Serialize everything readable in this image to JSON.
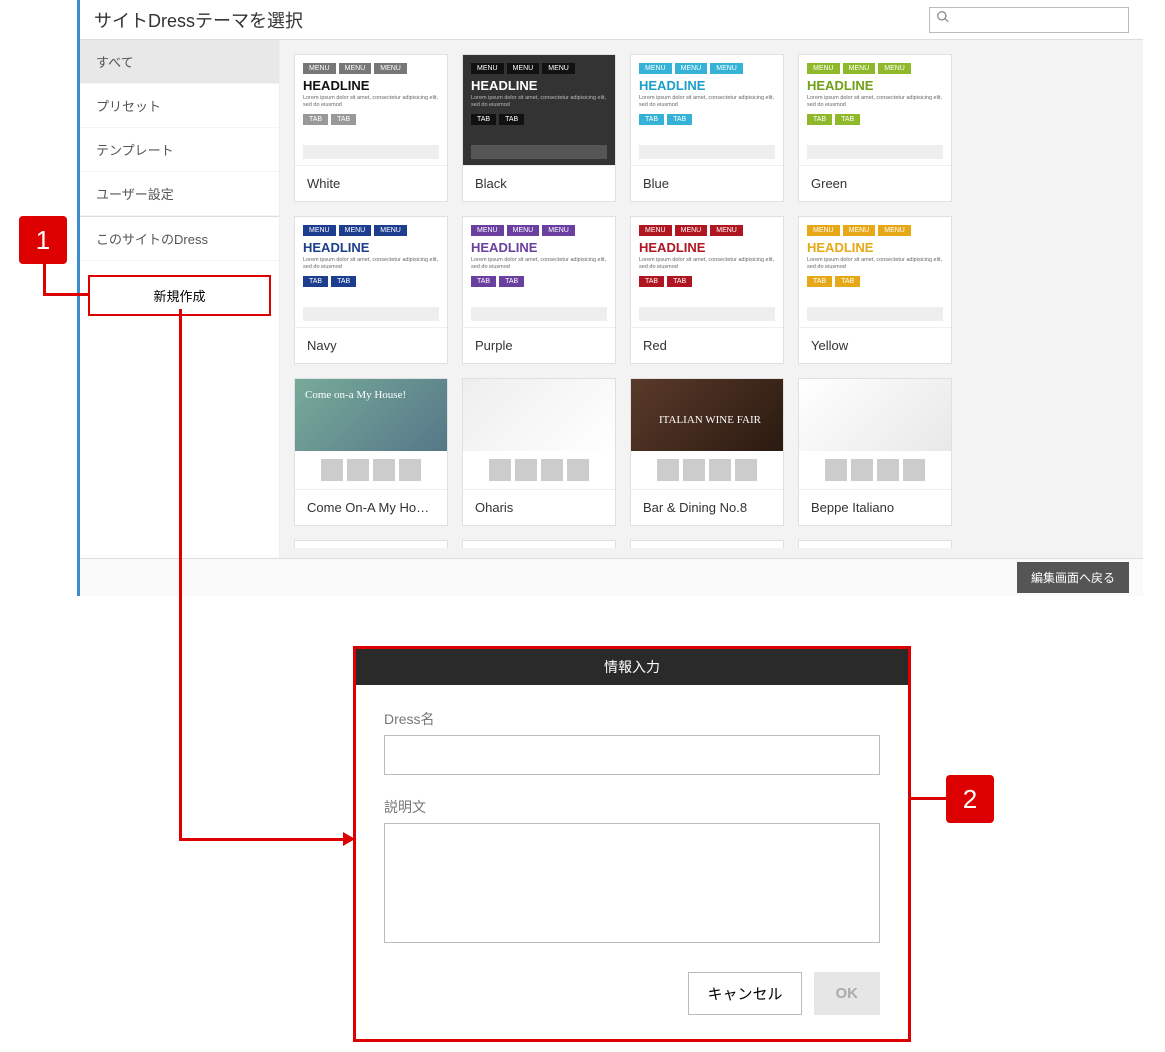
{
  "header": {
    "title": "サイトDressテーマを選択",
    "search_placeholder": ""
  },
  "sidebar": {
    "items": [
      {
        "label": "すべて",
        "active": true
      },
      {
        "label": "プリセット",
        "active": false
      },
      {
        "label": "テンプレート",
        "active": false
      },
      {
        "label": "ユーザー設定",
        "active": false
      }
    ],
    "site_dress_label": "このサイトのDress",
    "create_label": "新規作成"
  },
  "preview": {
    "menu": "MENU",
    "headline": "HEADLINE",
    "lorem": "Lorem ipsum dolor sit amet, consectetur adipisicing elit, sed do eiusmod",
    "tab": "TAB"
  },
  "themes_color": [
    {
      "label": "White",
      "menu_bg": "#777",
      "headline_color": "#111",
      "tab_bg": "#999",
      "dark": false
    },
    {
      "label": "Black",
      "menu_bg": "#111",
      "headline_color": "#fff",
      "tab_bg": "#111",
      "dark": true
    },
    {
      "label": "Blue",
      "menu_bg": "#35b2d6",
      "headline_color": "#1a9fc9",
      "tab_bg": "#35b2d6",
      "dark": false
    },
    {
      "label": "Green",
      "menu_bg": "#8fb92b",
      "headline_color": "#6f9f13",
      "tab_bg": "#8fb92b",
      "dark": false
    },
    {
      "label": "Navy",
      "menu_bg": "#1d3d8f",
      "headline_color": "#1d3d8f",
      "tab_bg": "#1d3d8f",
      "dark": false
    },
    {
      "label": "Purple",
      "menu_bg": "#6a3fa0",
      "headline_color": "#6a3fa0",
      "tab_bg": "#6a3fa0",
      "dark": false
    },
    {
      "label": "Red",
      "menu_bg": "#b01621",
      "headline_color": "#b01621",
      "tab_bg": "#b01621",
      "dark": false
    },
    {
      "label": "Yellow",
      "menu_bg": "#e6a817",
      "headline_color": "#e6a817",
      "tab_bg": "#e6a817",
      "dark": false
    }
  ],
  "themes_template": [
    {
      "label": "Come On-A My Ho…",
      "variant": "house"
    },
    {
      "label": "Oharis",
      "variant": "jewel"
    },
    {
      "label": "Bar & Dining No.8",
      "variant": "bar"
    },
    {
      "label": "Beppe Italiano",
      "variant": "beppe"
    }
  ],
  "footer": {
    "back_label": "編集画面へ戻る"
  },
  "dialog": {
    "title": "情報入力",
    "name_label": "Dress名",
    "desc_label": "説明文",
    "cancel": "キャンセル",
    "ok": "OK"
  },
  "callouts": {
    "one": "1",
    "two": "2"
  }
}
